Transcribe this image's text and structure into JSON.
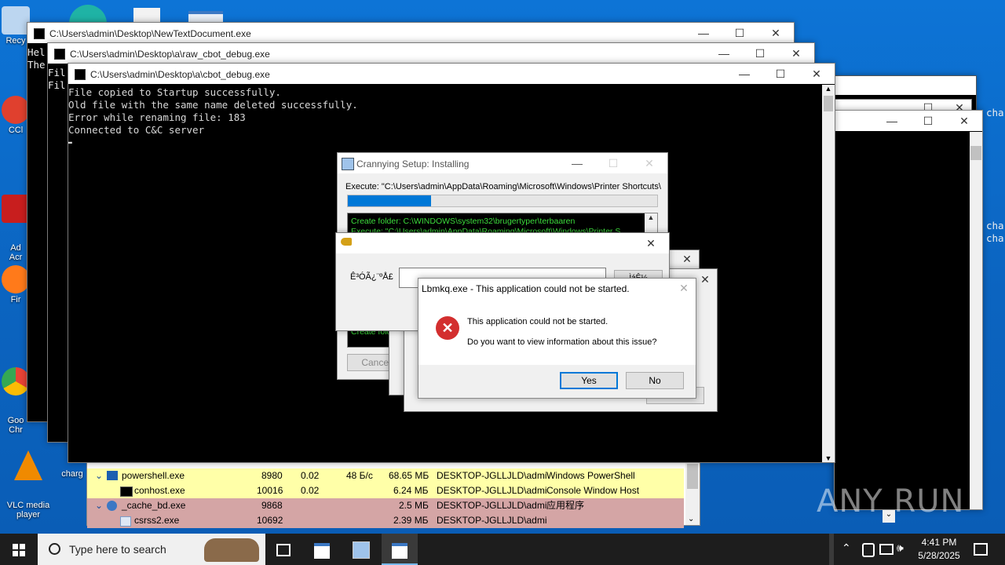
{
  "desktop": {
    "icons": [
      {
        "label": "Recy",
        "color": "#bcd6f0"
      },
      {
        "label": "CCl",
        "color": "#e0402e"
      },
      {
        "label": "Ad\nAcr",
        "color": "#c81e1e"
      },
      {
        "label": "Fir",
        "color": "#ff7a1a"
      },
      {
        "label": "Goo\nChr",
        "color": "#34a853"
      },
      {
        "label": "VLC media\nplayer",
        "color": "#f08a00"
      }
    ],
    "charg_label": "charg"
  },
  "windows": {
    "newtext": {
      "title": "C:\\Users\\admin\\Desktop\\NewTextDocument.exe",
      "lines": [
        "Hel",
        "The"
      ]
    },
    "raw_debug": {
      "title": "C:\\Users\\admin\\Desktop\\a\\raw_cbot_debug.exe",
      "lines": [
        "Fil",
        "Fil"
      ]
    },
    "cbot_debug": {
      "title": "C:\\Users\\admin\\Desktop\\a\\cbot_debug.exe",
      "lines": [
        "File copied to Startup successfully.",
        "Old file with the same name deleted successfully.",
        "Error while renaming file: 183",
        "Connected to C&C server"
      ],
      "cursor": "▬"
    },
    "right_console": {
      "lines_top": [
        "cha"
      ],
      "lines_mid": [
        "cha",
        "cha"
      ]
    },
    "setup": {
      "title": "Crannying Setup: Installing",
      "execute": "Execute: \"C:\\Users\\admin\\AppData\\Roaming\\Microsoft\\Windows\\Printer Shortcuts\\",
      "progress": 0.27,
      "log": [
        "Create folder: C:\\WINDOWS\\system32\\brugertyper\\terbaaren",
        "Execute: \"C:\\Users\\admin\\AppData\\Roaming\\Microsoft\\Windows\\Printer S"
      ],
      "log_partial": "Create folder",
      "side_letters": [
        "c",
        "V",
        "V"
      ],
      "cancel": "Cancel"
    },
    "key_dialog": {
      "label": "Ê³ÓÃ¿¨ºÅ£",
      "button": "ÌáÊ½"
    },
    "error_dialog": {
      "title": "Lbmkq.exe - This application could not be started.",
      "message1": "This application could not be started.",
      "message2": "Do you want to view information about this issue?",
      "yes": "Yes",
      "no": "No"
    }
  },
  "taskmgr": {
    "rows": [
      {
        "name": "powershell.exe",
        "pid": "8980",
        "cpu": "0.02",
        "disk": "48 Б/с",
        "mem": "68.65 МБ",
        "user": "DESKTOP-JGLLJLD\\admi",
        "desc": "Windows PowerShell",
        "bg": "#ffffa8",
        "expand": true
      },
      {
        "name": "conhost.exe",
        "pid": "10016",
        "cpu": "0.02",
        "disk": "",
        "mem": "6.24 МБ",
        "user": "DESKTOP-JGLLJLD\\admi",
        "desc": "Console Window Host",
        "bg": "#ffffa8",
        "expand": false
      },
      {
        "name": "_cache_bd.exe",
        "pid": "9868",
        "cpu": "",
        "disk": "",
        "mem": "2.5 МБ",
        "user": "DESKTOP-JGLLJLD\\admi",
        "desc": "应用程序",
        "bg": "#d4a5a5",
        "expand": true
      },
      {
        "name": "csrss2.exe",
        "pid": "10692",
        "cpu": "",
        "disk": "",
        "mem": "2.39 МБ",
        "user": "DESKTOP-JGLLJLD\\admi",
        "desc": "",
        "bg": "#d4a5a5",
        "expand": false
      }
    ]
  },
  "watermark": "ANY RUN",
  "taskbar": {
    "search_placeholder": "Type here to search",
    "time": "4:41 PM",
    "date": "5/28/2025"
  }
}
